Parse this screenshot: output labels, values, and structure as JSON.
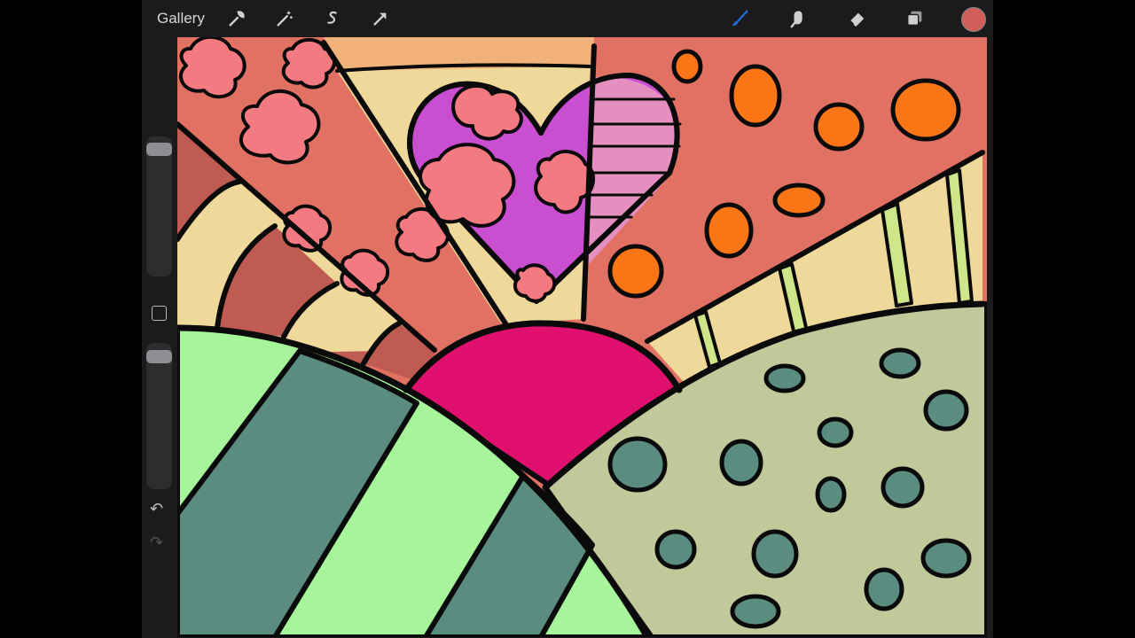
{
  "toolbar": {
    "gallery_label": "Gallery",
    "left_tools": [
      "wrench-icon",
      "magic-wand-icon",
      "selection-icon",
      "transform-arrow-icon"
    ],
    "right_tools": [
      "brush-icon",
      "smudge-icon",
      "eraser-icon",
      "layers-icon"
    ],
    "active_tool": "brush-icon",
    "accent_color": "#1f6fd6",
    "current_color": "#d05f5a"
  },
  "sidebar": {
    "brush_size_level": 0.95,
    "opacity_level": 0.95
  },
  "canvas": {
    "palette": {
      "salmon": "#e07163",
      "peach": "#f1b27a",
      "sand": "#efd99a",
      "brick": "#bf5b52",
      "pink_flower": "#f47a82",
      "purple": "#c94ed0",
      "light_pink": "#e48fc0",
      "magenta": "#e0106e",
      "orange": "#f97516",
      "lime": "#cfe58a",
      "mint": "#a7f59a",
      "teal": "#5a8c80",
      "sage": "#c1c99a",
      "outline": "#0a0a0a"
    }
  }
}
